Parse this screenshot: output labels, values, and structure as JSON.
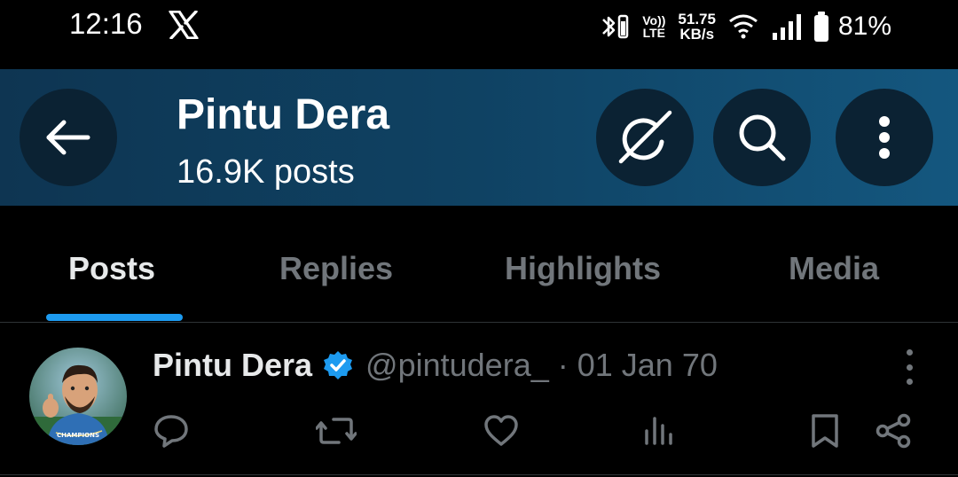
{
  "status_bar": {
    "time": "12:16",
    "volte_top": "Vo))",
    "volte_bottom": "LTE",
    "net_speed_value": "51.75",
    "net_speed_unit": "KB/s",
    "battery_percent": "81%"
  },
  "header": {
    "profile_name": "Pintu Dera",
    "post_count": "16.9K posts",
    "background_color": "#0f4263"
  },
  "tabs": [
    {
      "label": "Posts",
      "active": true
    },
    {
      "label": "Replies",
      "active": false
    },
    {
      "label": "Highlights",
      "active": false
    },
    {
      "label": "Media",
      "active": false
    }
  ],
  "post": {
    "author_name": "Pintu Dera",
    "verified": true,
    "handle": "@pintudera_",
    "separator": "·",
    "date": "01 Jan 70",
    "avatar_text": "CHAMPIONS"
  },
  "colors": {
    "accent": "#1d9bf0",
    "muted_text": "#71767b",
    "divider": "#2f3336"
  },
  "icons": [
    "x-logo-icon",
    "bluetooth-icon",
    "wifi-icon",
    "signal-icon",
    "battery-icon",
    "back-arrow-icon",
    "grok-icon",
    "search-icon",
    "more-vertical-icon",
    "verified-badge-icon",
    "reply-icon",
    "repost-icon",
    "like-icon",
    "views-icon",
    "bookmark-icon",
    "share-icon"
  ]
}
